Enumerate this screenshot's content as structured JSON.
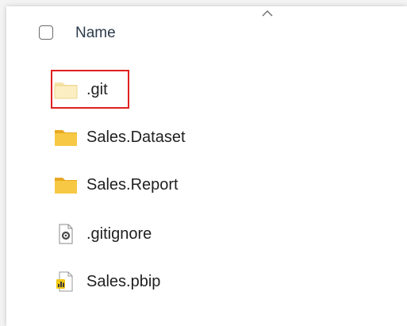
{
  "header": {
    "column_name": "Name",
    "sort_icon": "chevron-up-icon",
    "select_all_icon": "checkbox-icon"
  },
  "files": [
    {
      "label": ".git",
      "icon": "folder-icon",
      "highlighted": true
    },
    {
      "label": "Sales.Dataset",
      "icon": "folder-icon",
      "highlighted": false
    },
    {
      "label": "Sales.Report",
      "icon": "folder-icon",
      "highlighted": false
    },
    {
      "label": ".gitignore",
      "icon": "settings-file-icon",
      "highlighted": false
    },
    {
      "label": "Sales.pbip",
      "icon": "pbip-file-icon",
      "highlighted": false
    }
  ],
  "colors": {
    "highlight": "#e02020",
    "folder_body": "#f7c843",
    "folder_tab": "#e8a922",
    "text": "#1f1f1f"
  }
}
